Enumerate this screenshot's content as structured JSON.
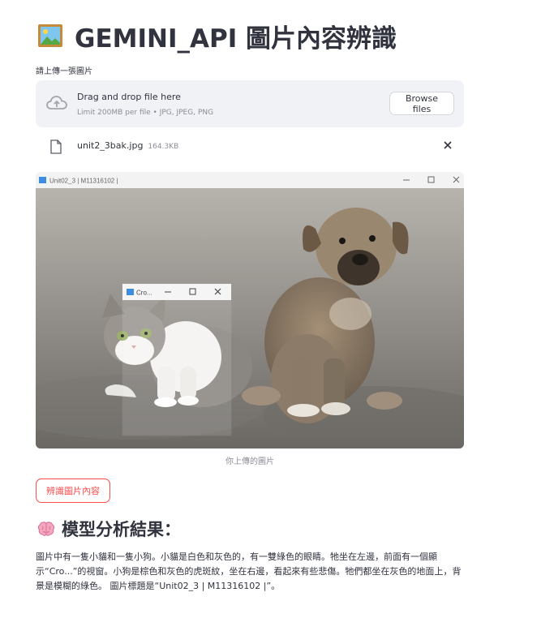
{
  "header": {
    "title": "GEMINI_API 圖片內容辨識",
    "title_icon": "framed-picture-emoji"
  },
  "uploader": {
    "label": "請上傳一張圖片",
    "drop_text": "Drag and drop file here",
    "limit_text": "Limit 200MB per file • JPG, JPEG, PNG",
    "browse_label": "Browse files",
    "icons": [
      "cloud-upload-icon",
      "file-icon",
      "close-icon"
    ]
  },
  "file": {
    "name": "unit2_3bak.jpg",
    "size": "164.3KB"
  },
  "image": {
    "window_title": "Unit02_3 | M11316102 |",
    "crop_window_title": "Cro...",
    "caption": "你上傳的圖片"
  },
  "actions": {
    "recognize_label": "辨識圖片內容"
  },
  "result": {
    "title": "模型分析結果：",
    "title_icon": "brain-emoji",
    "text": "圖片中有一隻小貓和一隻小狗。小貓是白色和灰色的，有一雙綠色的眼睛。牠坐在左邊，前面有一個顯示“Cro...”的視窗。小狗是棕色和灰色的虎斑紋，坐在右邊，看起來有些悲傷。牠們都坐在灰色的地面上，背景是模糊的綠色。 圖片標題是“Unit02_3 | M11316102 |”。"
  },
  "colors": {
    "text": "#31333f",
    "muted": "#8b8d96",
    "accent": "#ff4b4b",
    "dropzone_bg": "#f0f2f6"
  }
}
